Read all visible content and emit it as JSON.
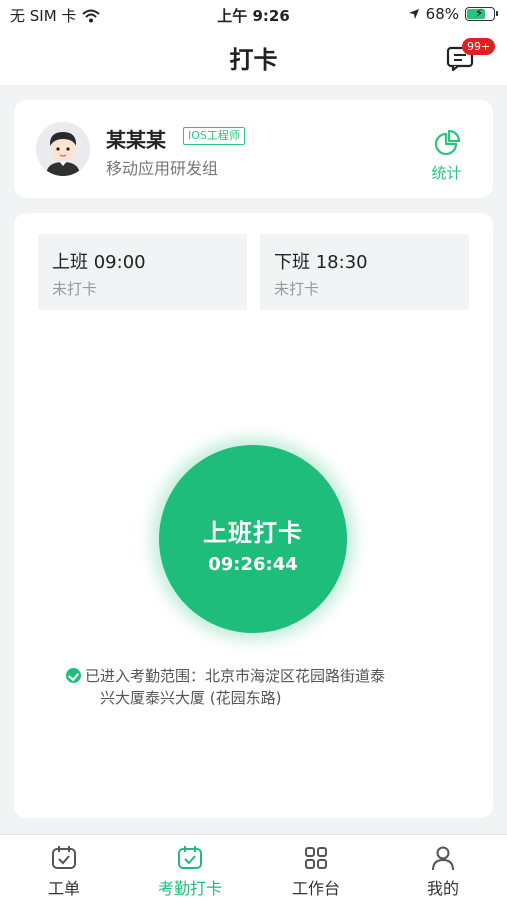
{
  "status_bar": {
    "carrier": "无 SIM 卡",
    "time": "上午 9:26",
    "battery": "68%"
  },
  "header": {
    "title": "打卡",
    "badge": "99+"
  },
  "user": {
    "name": "某某某",
    "role": "IOS工程师",
    "department": "移动应用研发组",
    "stats_label": "统计"
  },
  "shifts": [
    {
      "title": "上班 09:00",
      "status": "未打卡"
    },
    {
      "title": "下班 18:30",
      "status": "未打卡"
    }
  ],
  "clock": {
    "label": "上班打卡",
    "time": "09:26:44"
  },
  "location": {
    "line1": "已进入考勤范围：北京市海淀区花园路街道泰",
    "line2": "兴大厦泰兴大厦 (花园东路)"
  },
  "tabs": [
    {
      "label": "工单",
      "icon": "calendar-check-icon",
      "active": false
    },
    {
      "label": "考勤打卡",
      "icon": "calendar-check-icon",
      "active": true
    },
    {
      "label": "工作台",
      "icon": "grid-icon",
      "active": false
    },
    {
      "label": "我的",
      "icon": "person-icon",
      "active": false
    }
  ],
  "colors": {
    "accent": "#1fbd7c",
    "badge": "#e02020"
  }
}
